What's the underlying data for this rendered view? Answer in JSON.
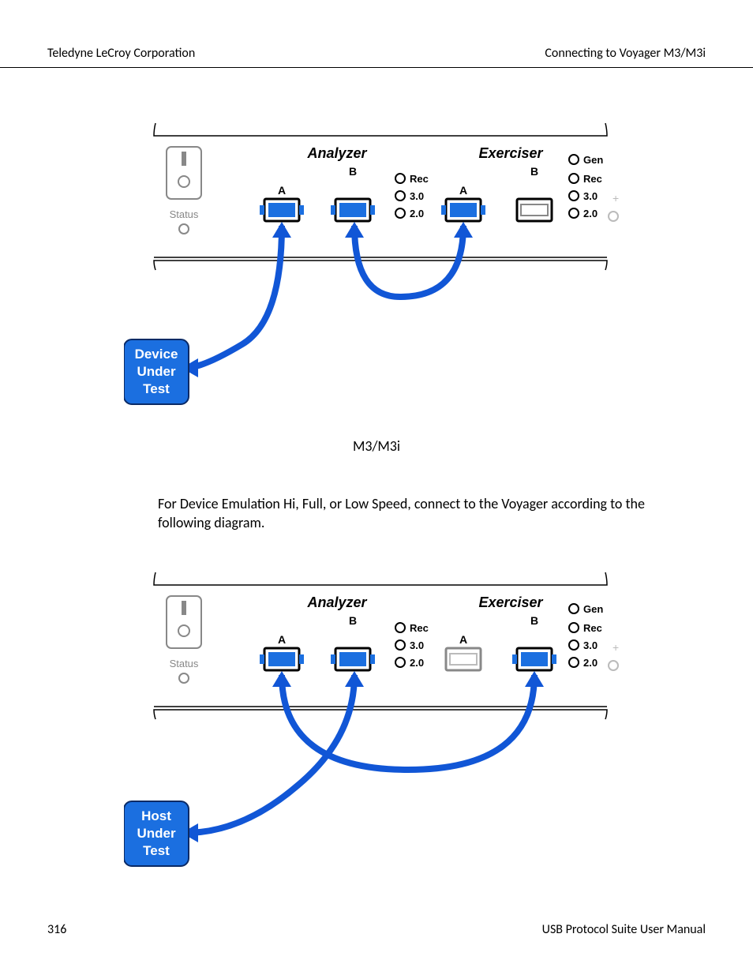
{
  "header": {
    "left": "Teledyne LeCroy Corporation",
    "right": "Connecting to Voyager M3/M3i"
  },
  "footer": {
    "left": "316",
    "right": "USB Protocol Suite User Manual"
  },
  "caption1": "M3/M3i",
  "body_para": "For Device Emulation Hi, Full, or Low Speed, connect to the Voyager according to the following diagram.",
  "panel": {
    "status": "Status",
    "analyzer": "Analyzer",
    "exerciser": "Exerciser",
    "A": "A",
    "B": "B",
    "leds": {
      "rec": "Rec",
      "v30": "3.0",
      "v20": "2.0",
      "gen": "Gen"
    }
  },
  "box1": {
    "l1": "Device",
    "l2": "Under",
    "l3": "Test"
  },
  "box2": {
    "l1": "Host",
    "l2": "Under",
    "l3": "Test"
  }
}
